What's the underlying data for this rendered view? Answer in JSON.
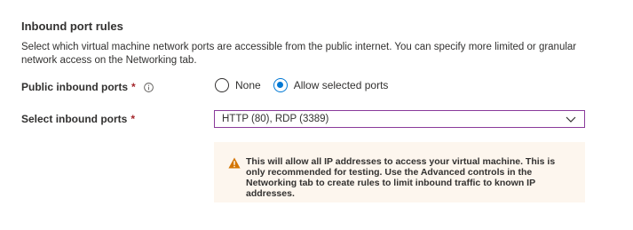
{
  "section": {
    "title": "Inbound port rules",
    "description": "Select which virtual machine network ports are accessible from the public internet. You can specify more limited or granular network access on the Networking tab."
  },
  "public_inbound": {
    "label": "Public inbound ports",
    "required_mark": "*",
    "options": [
      {
        "label": "None",
        "checked": false
      },
      {
        "label": "Allow selected ports",
        "checked": true
      }
    ]
  },
  "select_ports": {
    "label": "Select inbound ports",
    "required_mark": "*",
    "value": "HTTP (80), RDP (3389)"
  },
  "warning": {
    "icon": "warning-icon",
    "text": "This will allow all IP addresses to access your virtual machine.  This is only recommended for testing.  Use the Advanced controls in the Networking tab to create rules to limit inbound traffic to known IP addresses."
  },
  "colors": {
    "accent": "#0078d4",
    "required": "#a4262c",
    "select_border": "#8a3b9a",
    "warning_bg": "#fdf6ee",
    "warning_icon": "#d47500"
  }
}
